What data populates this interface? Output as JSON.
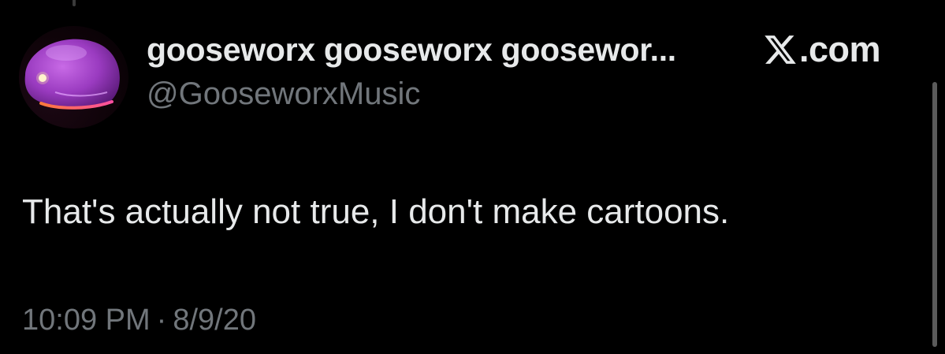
{
  "tweet": {
    "display_name": "gooseworx gooseworx goosewor...",
    "handle": "@GooseworxMusic",
    "text": "That's actually not true, I don't make cartoons.",
    "time": "10:09 PM",
    "separator": "·",
    "date": "8/9/20"
  },
  "brand": {
    "domain": ".com",
    "logo_icon": "x-logo-icon"
  },
  "colors": {
    "background": "#000000",
    "primary_text": "#e7e9ea",
    "secondary_text": "#71767b",
    "avatar_accent": "#b24bd6"
  }
}
